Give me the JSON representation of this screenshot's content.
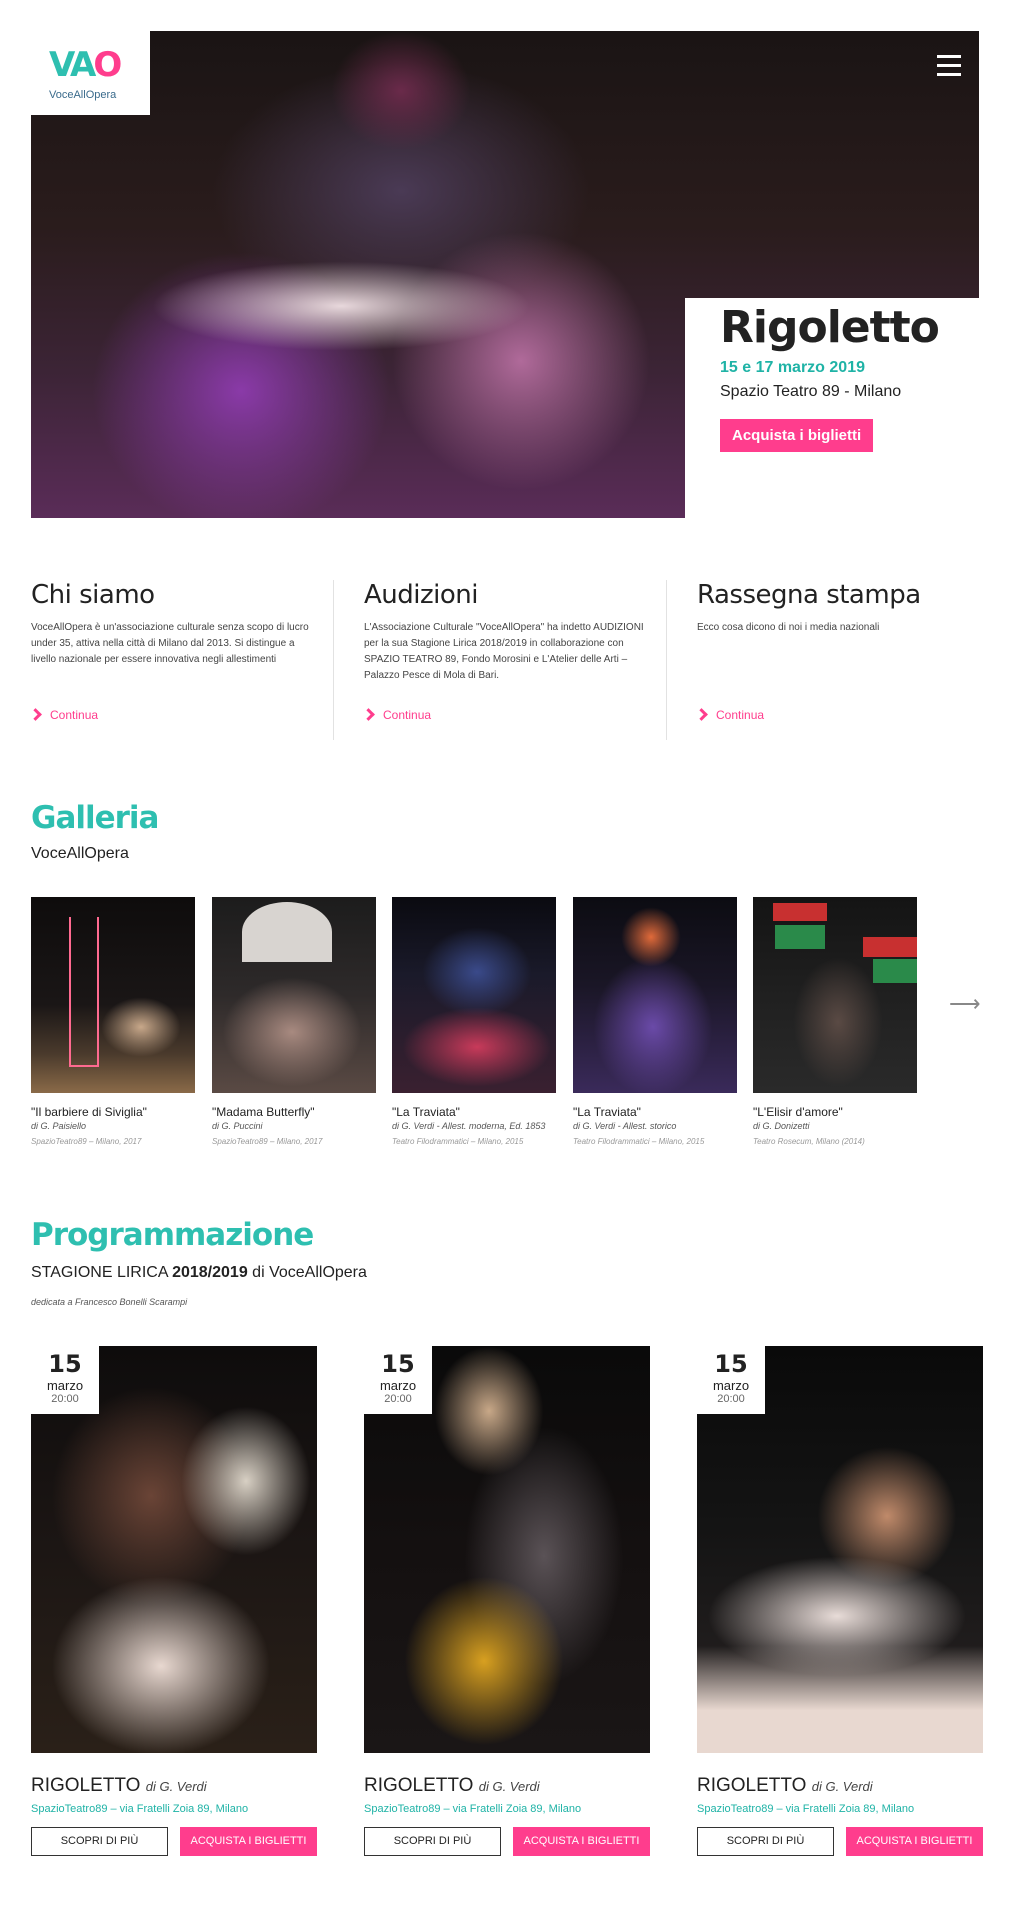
{
  "brand": {
    "mark_left": "VA",
    "mark_right": "O",
    "name": "VoceAllOpera"
  },
  "hero": {
    "title": "Rigoletto",
    "date": "15 e 17 marzo 2019",
    "venue": "Spazio Teatro 89 - Milano",
    "button": "Acquista i biglietti"
  },
  "info": [
    {
      "title": "Chi siamo",
      "text": "VoceAllOpera è un'associazione culturale senza scopo di lucro under 35, attiva nella città di Milano dal 2013. Si distingue a livello nazionale per essere innovativa negli allestimenti",
      "more": "Continua"
    },
    {
      "title": "Audizioni",
      "text": "L'Associazione Culturale \"VoceAllOpera\" ha indetto AUDIZIONI per la sua Stagione Lirica 2018/2019 in collaborazione con SPAZIO TEATRO 89, Fondo Morosini e L'Atelier delle Arti – Palazzo Pesce di Mola di Bari.",
      "more": "Continua"
    },
    {
      "title": "Rassegna stampa",
      "text": "Ecco cosa dicono di noi i media nazionali",
      "more": "Continua"
    }
  ],
  "gallery": {
    "title": "Galleria",
    "subtitle": "VoceAllOpera",
    "items": [
      {
        "title": "\"Il barbiere di Siviglia\"",
        "author": "di G. Paisiello",
        "venue": "SpazioTeatro89 – Milano, 2017"
      },
      {
        "title": "\"Madama Butterfly\"",
        "author": "di G. Puccini",
        "venue": "SpazioTeatro89 – Milano, 2017"
      },
      {
        "title": "\"La Traviata\"",
        "author": "di G. Verdi - Allest. moderna, Ed. 1853",
        "venue": "Teatro Filodrammatici – Milano, 2015"
      },
      {
        "title": "\"La Traviata\"",
        "author": "di G. Verdi - Allest. storico",
        "venue": "Teatro Filodrammatici – Milano, 2015"
      },
      {
        "title": "\"L'Elisir d'amore\"",
        "author": "di G. Donizetti",
        "venue": "Teatro Rosecum, Milano (2014)"
      }
    ],
    "arrow": "⟶"
  },
  "program": {
    "title": "Programmazione",
    "season_prefix": "STAGIONE LIRICA",
    "season_year": "2018/2019",
    "season_suffix": "di VoceAllOpera",
    "dedication": "dedicata a Francesco Bonelli Scarampi",
    "events": [
      {
        "day": "15",
        "month": "marzo",
        "time": "20:00",
        "title": "RIGOLETTO",
        "author": "di G. Verdi",
        "venue": "SpazioTeatro89 – via Fratelli Zoia 89, Milano",
        "btn_more": "SCOPRI DI PIÙ",
        "btn_buy": "ACQUISTA I BIGLIETTI"
      },
      {
        "day": "15",
        "month": "marzo",
        "time": "20:00",
        "title": "RIGOLETTO",
        "author": "di G. Verdi",
        "venue": "SpazioTeatro89 – via Fratelli Zoia 89, Milano",
        "btn_more": "SCOPRI DI PIÙ",
        "btn_buy": "ACQUISTA I BIGLIETTI"
      },
      {
        "day": "15",
        "month": "marzo",
        "time": "20:00",
        "title": "RIGOLETTO",
        "author": "di G. Verdi",
        "venue": "SpazioTeatro89 – via Fratelli Zoia 89, Milano",
        "btn_more": "SCOPRI DI PIÙ",
        "btn_buy": "ACQUISTA I BIGLIETTI"
      }
    ]
  },
  "colors": {
    "accent_pink": "#ff3d8d",
    "accent_teal": "#2ebfb0"
  }
}
